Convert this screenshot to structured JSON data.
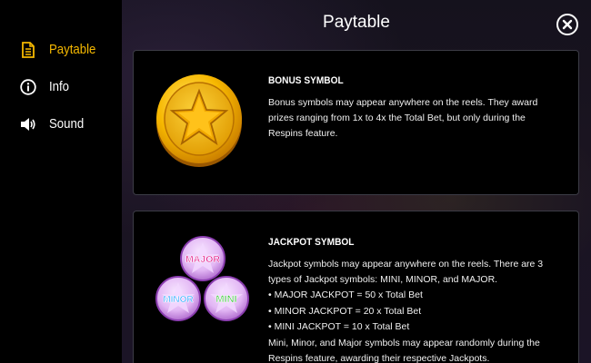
{
  "sidebar": {
    "items": [
      {
        "label": "Paytable",
        "icon": "document-icon",
        "active": true
      },
      {
        "label": "Info",
        "icon": "info-icon",
        "active": false
      },
      {
        "label": "Sound",
        "icon": "speaker-icon",
        "active": false
      }
    ]
  },
  "header": {
    "title": "Paytable"
  },
  "colors": {
    "accent": "#f5b800",
    "background": "#000000",
    "card_border": "#3c3c46"
  },
  "bonus": {
    "heading": "BONUS SYMBOL",
    "body": "Bonus symbols may appear anywhere on the reels. They award prizes ranging from 1x to 4x the Total Bet, but only during the Respins feature."
  },
  "jackpot": {
    "heading": "JACKPOT SYMBOL",
    "intro": "Jackpot symbols may appear anywhere on the reels. There are 3 types of Jackpot symbols: MINI, MINOR, and MAJOR.",
    "lines": [
      "• MAJOR JACKPOT = 50 x Total Bet",
      "• MINOR JACKPOT = 20 x Total Bet",
      "• MINI JACKPOT = 10 x Total Bet"
    ],
    "outro": "Mini, Minor, and Major symbols may appear randomly during the Respins feature, awarding their respective Jackpots.",
    "coins": {
      "major": "MAJOR",
      "minor": "MINOR",
      "mini": "MINI"
    }
  }
}
